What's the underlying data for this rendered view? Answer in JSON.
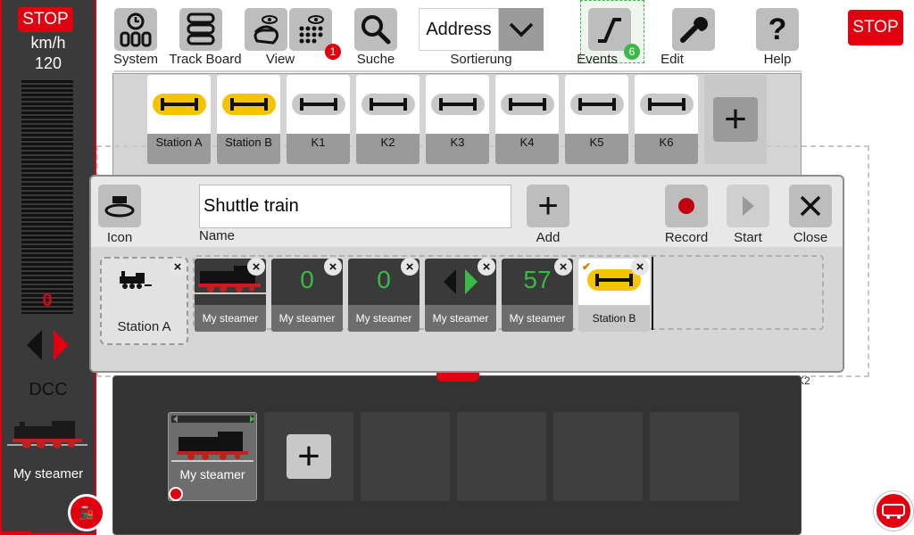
{
  "left_panel": {
    "stop_label": "STOP",
    "speed_unit": "km/h",
    "speed_max": "120",
    "current_speed": "0",
    "protocol": "DCC",
    "loco_name": "My steamer"
  },
  "toolbar": {
    "system": "System",
    "track_board": "Track Board",
    "view": "View",
    "view_badge": "1",
    "search": "Suche",
    "sort_value": "Address",
    "sort_label": "Sortierung",
    "events": "Events",
    "events_badge": "6",
    "edit": "Edit",
    "help": "Help",
    "stop_label": "STOP"
  },
  "track_board": {
    "tiles": [
      {
        "name": "Station A",
        "active": true
      },
      {
        "name": "Station B",
        "active": true
      },
      {
        "name": "K1",
        "active": false
      },
      {
        "name": "K2",
        "active": false
      },
      {
        "name": "K3",
        "active": false
      },
      {
        "name": "K4",
        "active": false
      },
      {
        "name": "K5",
        "active": false
      },
      {
        "name": "K6",
        "active": false
      }
    ]
  },
  "dialog": {
    "icon_label": "Icon",
    "name_label": "Name",
    "name_value": "Shuttle train",
    "add_label": "Add",
    "record_label": "Record",
    "start_label": "Start",
    "close_label": "Close",
    "start_station": "Station A",
    "steps": [
      {
        "type": "loco",
        "value": "",
        "caption": "My steamer"
      },
      {
        "type": "speed",
        "value": "0",
        "caption": "My steamer"
      },
      {
        "type": "speed",
        "value": "0",
        "caption": "My steamer"
      },
      {
        "type": "direction",
        "value": "",
        "caption": "My steamer"
      },
      {
        "type": "speed",
        "value": "57",
        "caption": "My steamer"
      },
      {
        "type": "station",
        "value": "",
        "caption": "Station B"
      }
    ]
  },
  "board_edge_label": "K2",
  "loco_bar": {
    "loco_name": "My steamer"
  },
  "colors": {
    "stop_red": "#e00010",
    "active_yellow": "#f5c400",
    "speed_green": "#3bb84a",
    "panel_dark": "#3a3a3a"
  }
}
